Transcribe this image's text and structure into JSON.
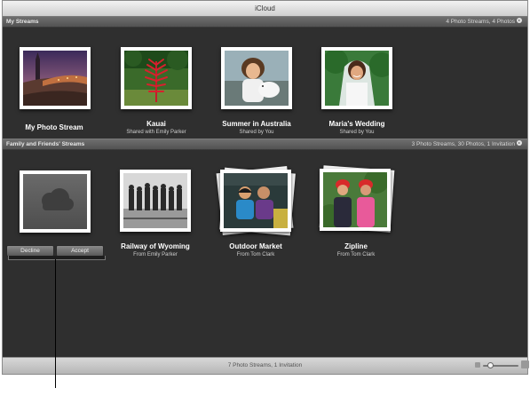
{
  "window": {
    "title": "iCloud"
  },
  "my_streams": {
    "header": "My Streams",
    "info": "4 Photo Streams, 4 Photos",
    "items": [
      {
        "title": "My Photo Stream",
        "subtitle": "",
        "photo": "sunset-plaza-photo"
      },
      {
        "title": "Kauai",
        "subtitle": "Shared with Emily Parker",
        "photo": "red-plant-photo"
      },
      {
        "title": "Summer in Australia",
        "subtitle": "Shared by You",
        "photo": "girl-with-dog-photo"
      },
      {
        "title": "Maria's Wedding",
        "subtitle": "Shared by You",
        "photo": "bride-photo"
      }
    ]
  },
  "friends_streams": {
    "header": "Family and Friends' Streams",
    "info": "3 Photo Streams, 30 Photos, 1 Invitation",
    "invitation": {
      "photo": "cloud-icon",
      "decline_label": "Decline",
      "accept_label": "Accept"
    },
    "items": [
      {
        "title": "Railway of Wyoming",
        "subtitle": "From Emily Parker",
        "photo": "railway-workers-photo"
      },
      {
        "title": "Outdoor Market",
        "subtitle": "From Tom Clark",
        "photo": "market-couple-photo"
      },
      {
        "title": "Zipline",
        "subtitle": "From Tom Clark",
        "photo": "zipline-couple-photo"
      }
    ]
  },
  "status_bar": {
    "text": "7 Photo Streams, 1 Invitation",
    "zoom_level": 0.15
  },
  "colors": {
    "background": "#2f2f2f",
    "header": "#5f5f5f"
  }
}
